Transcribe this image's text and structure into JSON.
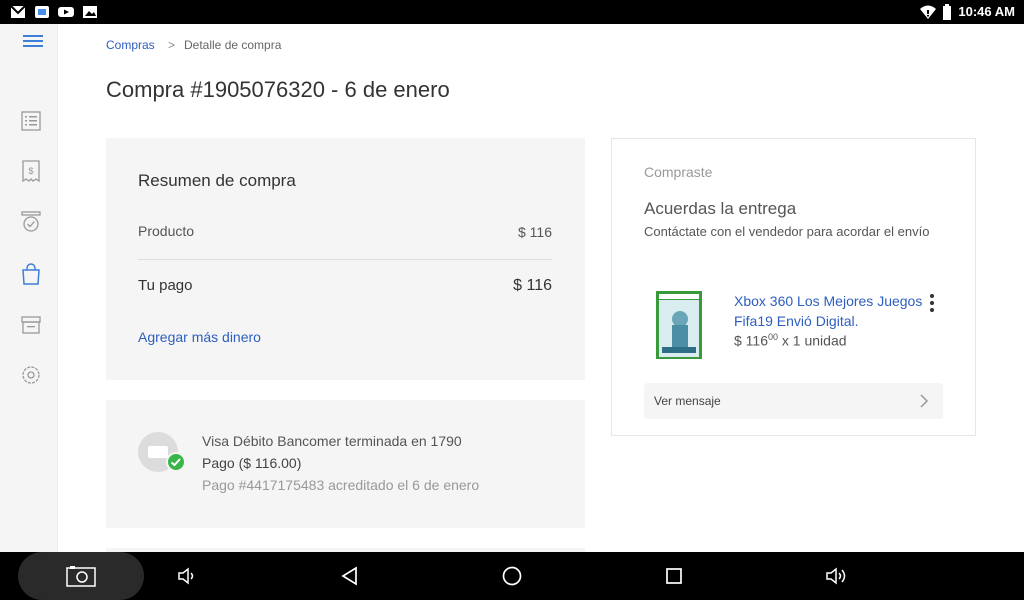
{
  "status_bar": {
    "time": "10:46 AM",
    "left_icons": [
      "gmail-icon",
      "maps-icon",
      "youtube-icon",
      "gallery-icon"
    ],
    "right_icons": [
      "wifi-icon",
      "battery-icon"
    ]
  },
  "sidebar": {
    "items": [
      {
        "name": "menu-icon"
      },
      {
        "name": "list-icon"
      },
      {
        "name": "receipt-icon"
      },
      {
        "name": "badge-icon"
      },
      {
        "name": "shopping-bag-icon",
        "active": true
      },
      {
        "name": "store-icon"
      },
      {
        "name": "settings-icon"
      }
    ]
  },
  "breadcrumb": {
    "link": "Compras",
    "separator": ">",
    "current": "Detalle de compra"
  },
  "page": {
    "title": "Compra #1905076320 - 6 de enero"
  },
  "summary": {
    "title": "Resumen de compra",
    "product_label": "Producto",
    "product_value": "$ 116",
    "payment_label": "Tu pago",
    "payment_value": "$ 116",
    "add_money_link": "Agregar más dinero"
  },
  "payment": {
    "card_line": "Visa Débito Bancomer terminada en 1790",
    "amount_line": "Pago ($ 116.00)",
    "detail_line": "Pago #4417175483 acreditado el 6 de enero"
  },
  "purchase": {
    "label": "Compraste",
    "heading": "Acuerdas la entrega",
    "description": "Contáctate con el vendedor para acordar el envío",
    "product_title": "Xbox 360 Los Mejores Juegos Fifa19 Envió Digital.",
    "price_main": "$ 116",
    "price_cents": "00",
    "quantity": " x 1 unidad",
    "message_button": "Ver mensaje"
  },
  "colors": {
    "link": "#2d5ec0",
    "accent_green": "#39b54a",
    "panel_bg": "#f5f5f5"
  },
  "nav_bar": {
    "icons": [
      "screenshot-icon",
      "volume-down-icon",
      "back-icon",
      "home-icon",
      "recents-icon",
      "volume-up-icon"
    ]
  }
}
